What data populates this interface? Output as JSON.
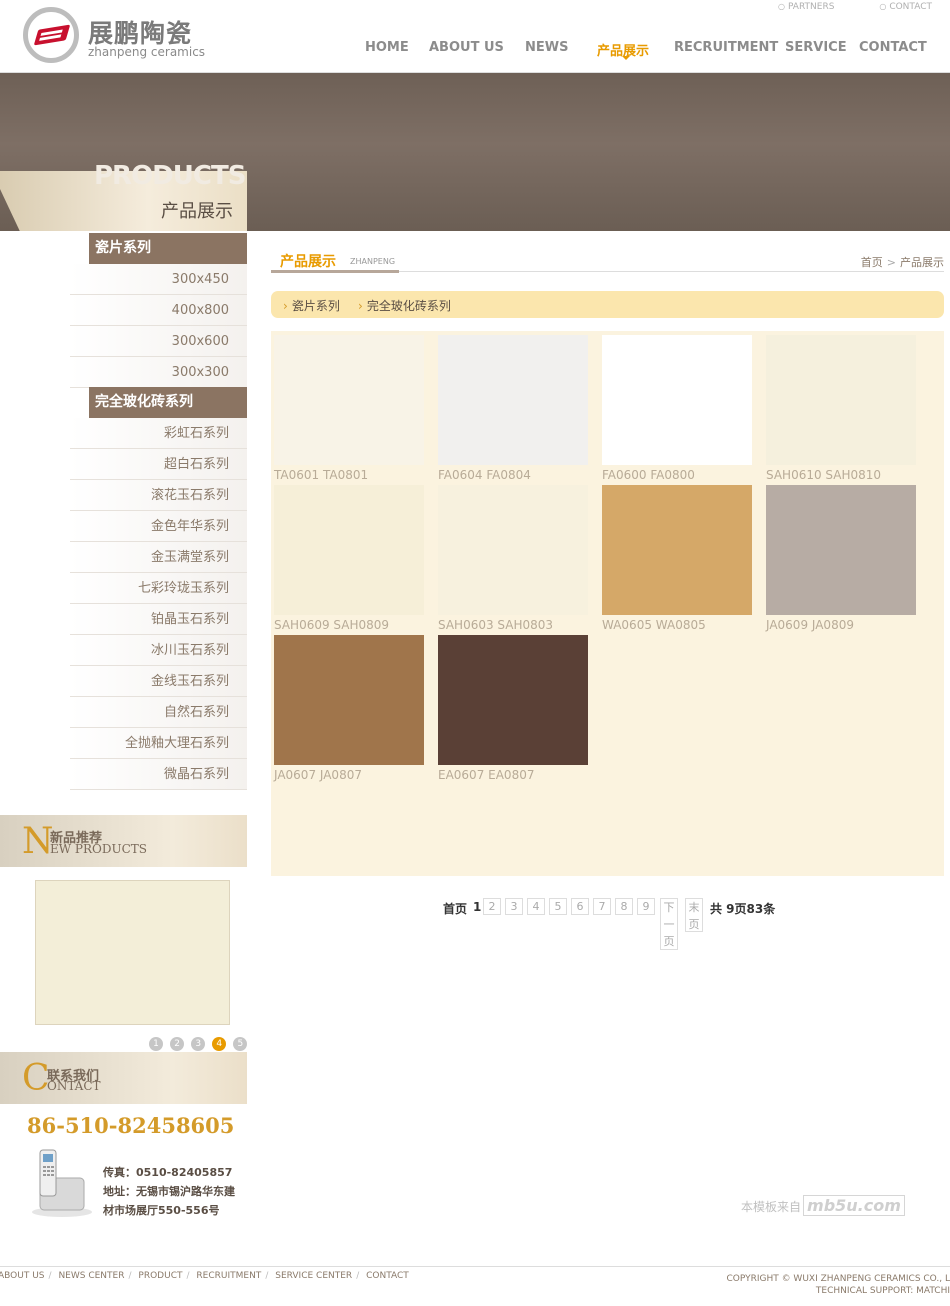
{
  "header": {
    "logo_cn": "展鹏陶瓷",
    "logo_en": "zhanpeng ceramics",
    "top_links": [
      "PARTNERS",
      "CONTACT"
    ],
    "nav": [
      "HOME",
      "ABOUT US",
      "NEWS",
      "产品展示",
      "RECRUITMENT",
      "SERVICE",
      "CONTACT"
    ],
    "nav_active": "产品展示"
  },
  "banner": {
    "en": "PRODUCTS",
    "cn": "产品展示"
  },
  "sidebar": {
    "categories": [
      {
        "label": "瓷片系列",
        "items": [
          "300x450",
          "400x800",
          "300x600",
          "300x300"
        ]
      },
      {
        "label": "完全玻化砖系列",
        "items": [
          "彩虹石系列",
          "超白石系列",
          "滚花玉石系列",
          "金色年华系列",
          "金玉满堂系列",
          "七彩玲珑玉系列",
          "铂晶玉石系列",
          "冰川玉石系列",
          "金线玉石系列",
          "自然石系列",
          "全抛釉大理石系列",
          "微晶石系列"
        ]
      }
    ],
    "new_products": {
      "letter": "N",
      "cn": "新品推荐",
      "en": "EW PRODUCTS",
      "dots": [
        "1",
        "2",
        "3",
        "4",
        "5"
      ],
      "active_dot": "4"
    },
    "contact": {
      "letter": "C",
      "cn": "联系我们",
      "en": "ONTACT",
      "phone": "86-510-82458605",
      "fax": "传真：0510-82405857",
      "address_1": "地址：无锡市锡沪路华东建",
      "address_2": "材市场展厅550-556号"
    }
  },
  "main": {
    "title_cn": "产品展示",
    "title_en": "ZHANPENG",
    "breadcrumb": [
      "首页",
      "产品展示"
    ],
    "tabs": [
      "瓷片系列",
      "完全玻化砖系列"
    ],
    "products": [
      {
        "name": "TA0601 TA0801",
        "color": "#f8f3e7"
      },
      {
        "name": "FA0604 FA0804",
        "color": "#f1f0ee"
      },
      {
        "name": "FA0600 FA0800",
        "color": "#ffffff"
      },
      {
        "name": "SAH0610 SAH0810",
        "color": "#f5f0dd"
      },
      {
        "name": "SAH0609 SAH0809",
        "color": "#f6efd8"
      },
      {
        "name": "SAH0603 SAH0803",
        "color": "#f7f1de"
      },
      {
        "name": "WA0605 WA0805",
        "color": "#d5a868"
      },
      {
        "name": "JA0609 JA0809",
        "color": "#b7aca4"
      },
      {
        "name": "JA0607 JA0807",
        "color": "#a0754b"
      },
      {
        "name": "EA0607 EA0807",
        "color": "#5a4036"
      }
    ],
    "pager": {
      "first": "首页",
      "current": "1",
      "pages": [
        "2",
        "3",
        "4",
        "5",
        "6",
        "7",
        "8",
        "9"
      ],
      "next": "下一页",
      "last": "末页",
      "total": "共  9页83条"
    }
  },
  "credit": {
    "text": "本模板来自",
    "brand": "mb5u.com"
  },
  "footer": {
    "links": [
      "ABOUT US",
      "NEWS CENTER",
      "PRODUCT",
      "RECRUITMENT",
      "SERVICE CENTER",
      "CONTACT"
    ],
    "copyright": "COPYRIGHT © WUXI ZHANPENG CERAMICS CO., L",
    "support": "TECHNICAL SUPPORT: MATCHI"
  }
}
